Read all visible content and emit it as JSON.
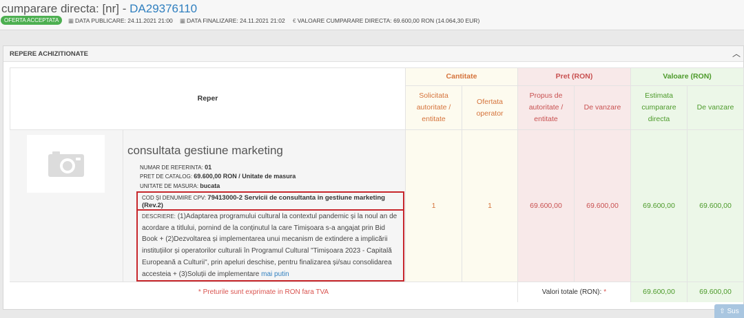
{
  "header": {
    "title_prefix": "cumparare directa: [nr] - ",
    "title_code": "DA29376110",
    "status_badge": "OFERTA ACCEPTATA",
    "publish_label": "DATA PUBLICARE: 24.11.2021 21:00",
    "deadline_label": "DATA FINALIZARE: 24.11.2021 21:02",
    "value_label": "VALOARE CUMPARARE DIRECTA: 69.600,00   RON (14.064,30   EUR)",
    "icons": {
      "calendar": "calendar-icon",
      "euro": "euro-icon"
    }
  },
  "section": {
    "title": "REPERE ACHIZITIONATE",
    "collapse_icon": "chevron-up-icon"
  },
  "table": {
    "headers": {
      "reper": "Reper",
      "cantitate": "Cantitate",
      "pret": "Pret (RON)",
      "valoare": "Valoare (RON)",
      "solicitata": "Solicitata autoritate / entitate",
      "oferta": "Ofertata operator",
      "propus": "Propus de autoritate / entitate",
      "de_vanzare_pret": "De vanzare",
      "estimata": "Estimata cumparare directa",
      "de_vanzare_val": "De vanzare"
    },
    "item": {
      "name": "consultata gestiune marketing",
      "image_icon": "camera-placeholder-icon",
      "ref_label": "NUMAR DE REFERINTA:",
      "ref_value": "01",
      "catalog_label": "PRET DE CATALOG:",
      "catalog_value": "69.600,00  RON / Unitate de masura",
      "unit_label": "UNITATE DE MASURA:",
      "unit_value": "bucata",
      "cpv_label": "COD ŞI DENUMIRE CPV:",
      "cpv_value": "79413000-2 Servicii de consultanta in gestiune marketing (Rev.2)",
      "desc_label": "DESCRIERE:",
      "desc_text": "(1)Adaptarea programului cultural la contextul pandemic și la noul an de acordare a titlului, pornind de la conținutul la care Timișoara s-a angajat prin Bid Book + (2)Dezvoltarea și implementarea unui mecanism de extindere a implicării instituțiilor și operatorilor culturali în Programul Cultural \"Timișoara 2023 - Capitală Europeană a Culturii\", prin apeluri deschise, pentru finalizarea și/sau consolidarea accesteia + (3)Soluții de implementare",
      "desc_more": "mai putin",
      "qty_requested": "1",
      "qty_offered": "1",
      "price_proposed": "69.600,00",
      "price_sale": "69.600,00",
      "value_estimated": "69.600,00",
      "value_sale": "69.600,00"
    },
    "note": "* Preturile sunt exprimate in RON fara TVA",
    "totals_label": "Valori totale (RON):",
    "totals_star": "*",
    "total_estimated": "69.600,00",
    "total_sale": "69.600,00"
  },
  "scroll_top": "Sus"
}
